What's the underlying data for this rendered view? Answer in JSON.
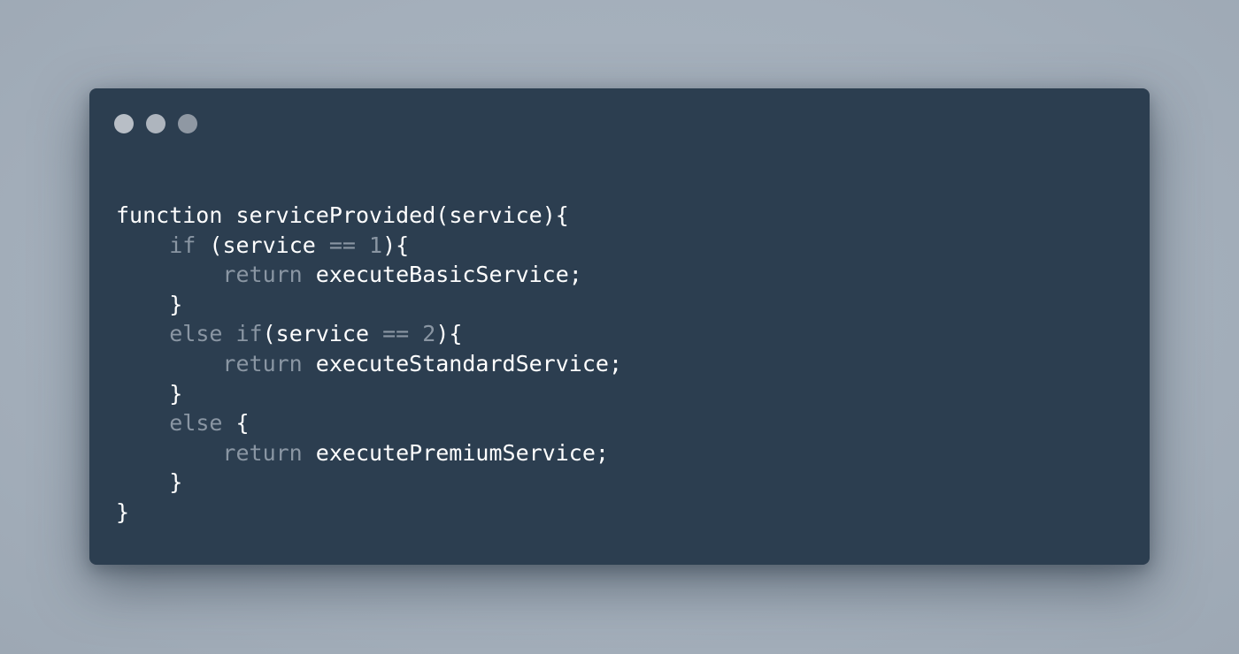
{
  "colors": {
    "background": "#a6b1bd",
    "window": "#2c3e50",
    "dot_1": "#b8bec6",
    "dot_2": "#aeb5be",
    "dot_3": "#8f98a3",
    "text_default": "#ffffff",
    "text_muted": "#8a96a3"
  },
  "window_controls": [
    "control-dot",
    "control-dot",
    "control-dot"
  ],
  "code": {
    "language": "javascript",
    "lines": [
      {
        "indent": 0,
        "tokens": [
          {
            "type": "ident",
            "text": "function"
          },
          {
            "type": "punct",
            "text": " "
          },
          {
            "type": "ident",
            "text": "serviceProvided"
          },
          {
            "type": "punct",
            "text": "("
          },
          {
            "type": "ident",
            "text": "service"
          },
          {
            "type": "punct",
            "text": "){"
          }
        ]
      },
      {
        "indent": 1,
        "tokens": [
          {
            "type": "kw",
            "text": "if"
          },
          {
            "type": "punct",
            "text": " ("
          },
          {
            "type": "ident",
            "text": "service"
          },
          {
            "type": "punct",
            "text": " "
          },
          {
            "type": "op",
            "text": "=="
          },
          {
            "type": "punct",
            "text": " "
          },
          {
            "type": "num",
            "text": "1"
          },
          {
            "type": "punct",
            "text": "){"
          }
        ]
      },
      {
        "indent": 2,
        "tokens": [
          {
            "type": "kw",
            "text": "return"
          },
          {
            "type": "punct",
            "text": " "
          },
          {
            "type": "ident",
            "text": "executeBasicService"
          },
          {
            "type": "punct",
            "text": ";"
          }
        ]
      },
      {
        "indent": 1,
        "tokens": [
          {
            "type": "punct",
            "text": "}"
          }
        ]
      },
      {
        "indent": 1,
        "tokens": [
          {
            "type": "kw",
            "text": "else"
          },
          {
            "type": "punct",
            "text": " "
          },
          {
            "type": "kw",
            "text": "if"
          },
          {
            "type": "punct",
            "text": "("
          },
          {
            "type": "ident",
            "text": "service"
          },
          {
            "type": "punct",
            "text": " "
          },
          {
            "type": "op",
            "text": "=="
          },
          {
            "type": "punct",
            "text": " "
          },
          {
            "type": "num",
            "text": "2"
          },
          {
            "type": "punct",
            "text": "){"
          }
        ]
      },
      {
        "indent": 2,
        "tokens": [
          {
            "type": "kw",
            "text": "return"
          },
          {
            "type": "punct",
            "text": " "
          },
          {
            "type": "ident",
            "text": "executeStandardService"
          },
          {
            "type": "punct",
            "text": ";"
          }
        ]
      },
      {
        "indent": 1,
        "tokens": [
          {
            "type": "punct",
            "text": "}"
          }
        ]
      },
      {
        "indent": 1,
        "tokens": [
          {
            "type": "kw",
            "text": "else"
          },
          {
            "type": "punct",
            "text": " {"
          }
        ]
      },
      {
        "indent": 2,
        "tokens": [
          {
            "type": "kw",
            "text": "return"
          },
          {
            "type": "punct",
            "text": " "
          },
          {
            "type": "ident",
            "text": "executePremiumService"
          },
          {
            "type": "punct",
            "text": ";"
          }
        ]
      },
      {
        "indent": 1,
        "tokens": [
          {
            "type": "punct",
            "text": "}"
          }
        ]
      },
      {
        "indent": 0,
        "tokens": [
          {
            "type": "punct",
            "text": "}"
          }
        ]
      }
    ]
  }
}
